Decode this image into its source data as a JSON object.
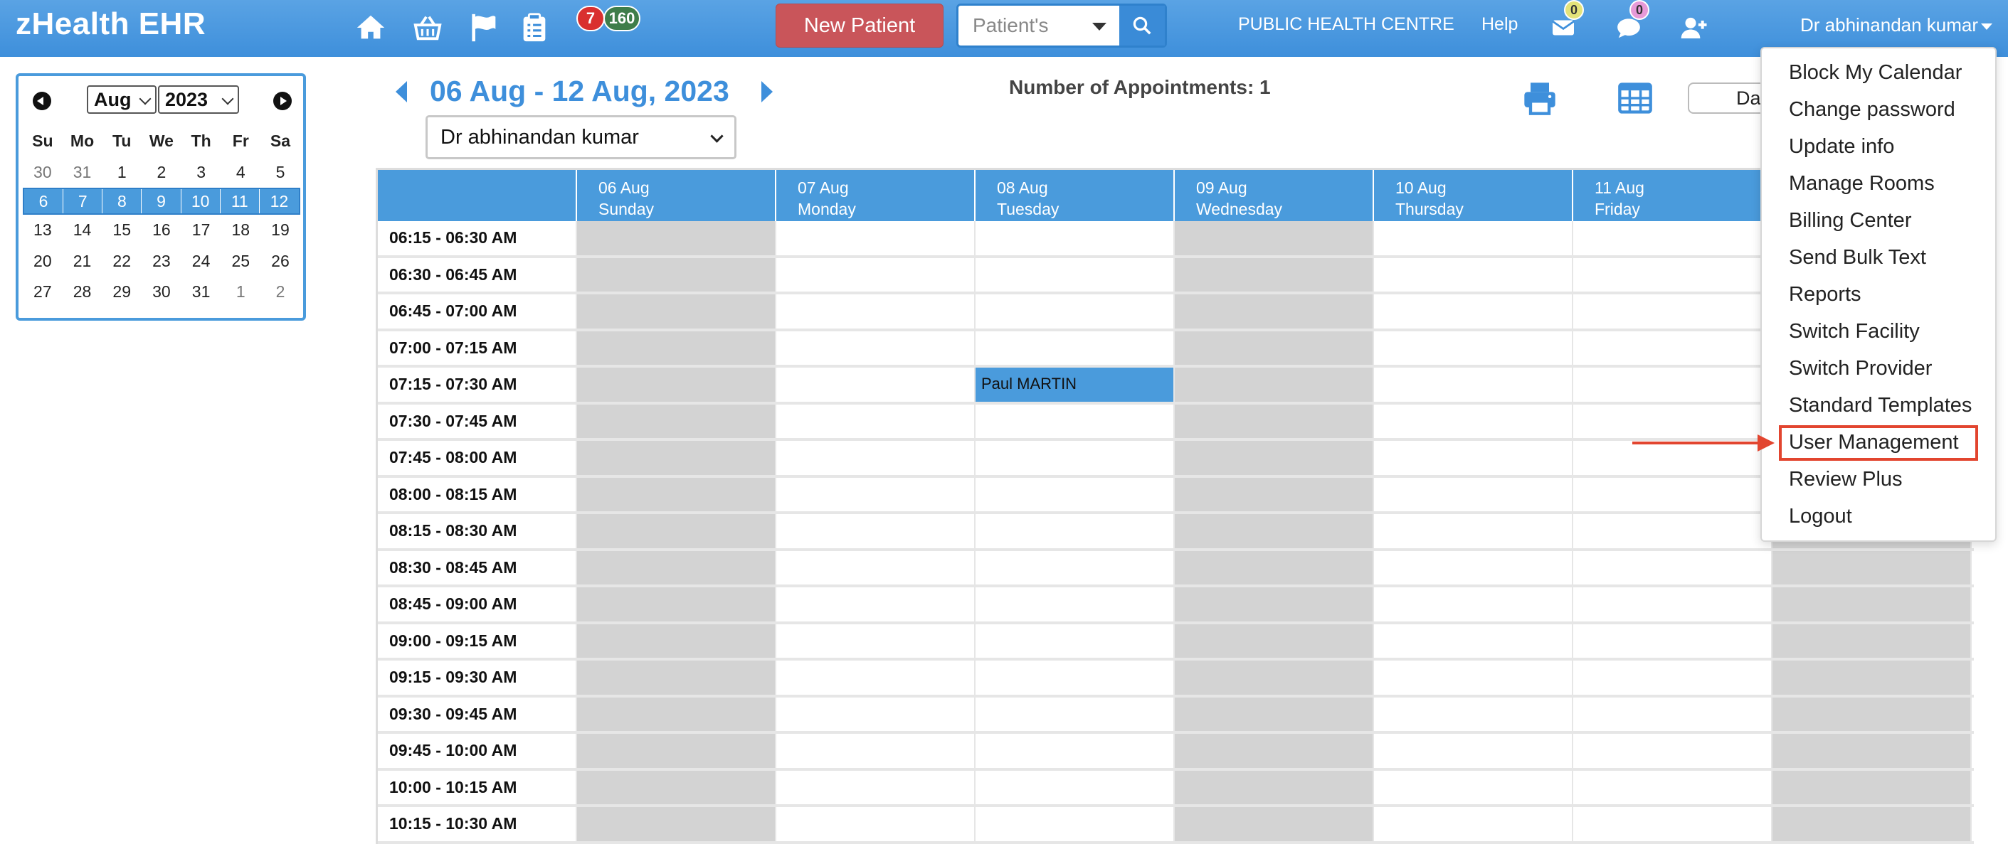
{
  "app": {
    "title": "zHealth EHR"
  },
  "header": {
    "notifications": {
      "red_badge": "7",
      "green_badge": "160",
      "mail_badge": "0",
      "chat_badge": "0"
    },
    "new_patient_label": "New Patient",
    "search": {
      "selected": "Patient's"
    },
    "facility": "PUBLIC HEALTH CENTRE",
    "help": "Help",
    "user": "Dr abhinandan kumar"
  },
  "mini_calendar": {
    "month": "Aug",
    "year": "2023",
    "weekdays": [
      "Su",
      "Mo",
      "Tu",
      "We",
      "Th",
      "Fr",
      "Sa"
    ],
    "weeks": [
      [
        "30",
        "31",
        "1",
        "2",
        "3",
        "4",
        "5"
      ],
      [
        "6",
        "7",
        "8",
        "9",
        "10",
        "11",
        "12"
      ],
      [
        "13",
        "14",
        "15",
        "16",
        "17",
        "18",
        "19"
      ],
      [
        "20",
        "21",
        "22",
        "23",
        "24",
        "25",
        "26"
      ],
      [
        "27",
        "28",
        "29",
        "30",
        "31",
        "1",
        "2"
      ]
    ]
  },
  "schedule": {
    "range_title": "06 Aug - 12 Aug, 2023",
    "appointment_count": "Number of Appointments: 1",
    "provider": "Dr abhinandan kumar",
    "view_button": "Da",
    "days": [
      {
        "date": "06 Aug",
        "name": "Sunday"
      },
      {
        "date": "07 Aug",
        "name": "Monday"
      },
      {
        "date": "08 Aug",
        "name": "Tuesday"
      },
      {
        "date": "09 Aug",
        "name": "Wednesday"
      },
      {
        "date": "10 Aug",
        "name": "Thursday"
      },
      {
        "date": "11 Aug",
        "name": "Friday"
      },
      {
        "date": "",
        "name": ""
      }
    ],
    "slots": [
      "06:15 - 06:30 AM",
      "06:30 - 06:45 AM",
      "06:45 - 07:00 AM",
      "07:00 - 07:15 AM",
      "07:15 - 07:30 AM",
      "07:30 - 07:45 AM",
      "07:45 - 08:00 AM",
      "08:00 - 08:15 AM",
      "08:15 - 08:30 AM",
      "08:30 - 08:45 AM",
      "08:45 - 09:00 AM",
      "09:00 - 09:15 AM",
      "09:15 - 09:30 AM",
      "09:30 - 09:45 AM",
      "09:45 - 10:00 AM",
      "10:00 - 10:15 AM",
      "10:15 - 10:30 AM"
    ],
    "appointment": {
      "patient": "Paul MARTIN"
    }
  },
  "user_menu": {
    "items": [
      "Block My Calendar",
      "Change password",
      "Update info",
      "Manage Rooms",
      "Billing Center",
      "Send Bulk Text",
      "Reports",
      "Switch Facility",
      "Switch Provider",
      "Standard Templates",
      "User Management",
      "Review Plus",
      "Logout"
    ]
  },
  "colors": {
    "brand": "#3e8fdb",
    "new_patient": "#c9555a",
    "blocked": "#d3d3d3",
    "highlight": "#e2452f"
  }
}
